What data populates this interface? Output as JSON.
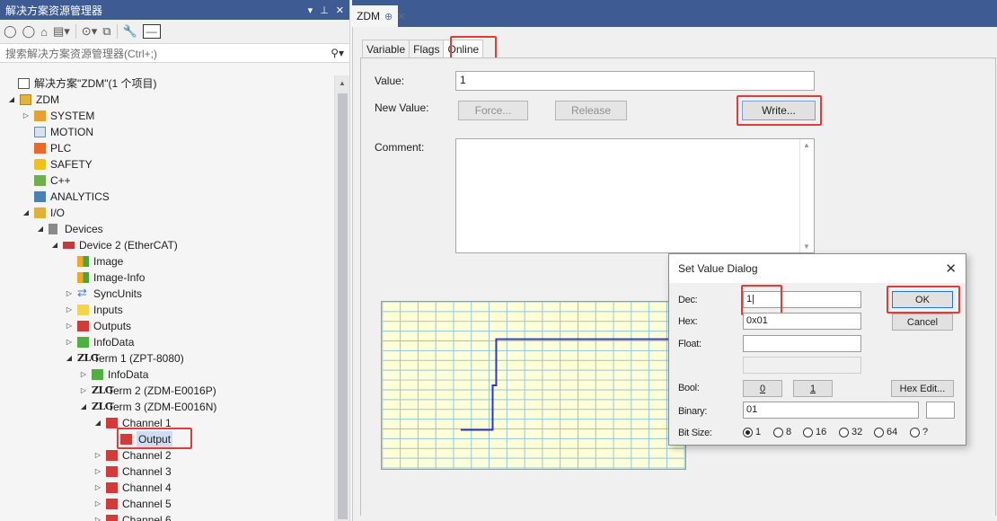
{
  "explorer": {
    "title": "解决方案资源管理器",
    "title_controls": [
      "▾",
      "⊥",
      "✕"
    ],
    "search_placeholder": "搜索解决方案资源管理器(Ctrl+;)",
    "tree": [
      {
        "label": "解决方案\"ZDM\"(1 个项目)",
        "icon": "solution-icon"
      },
      {
        "label": "ZDM",
        "icon": "project-icon"
      },
      {
        "label": "SYSTEM",
        "icon": "system-icon"
      },
      {
        "label": "MOTION",
        "icon": "motion-icon"
      },
      {
        "label": "PLC",
        "icon": "plc-icon"
      },
      {
        "label": "SAFETY",
        "icon": "safety-icon"
      },
      {
        "label": "C++",
        "icon": "cpp-icon"
      },
      {
        "label": "ANALYTICS",
        "icon": "analytics-icon"
      },
      {
        "label": "I/O",
        "icon": "io-icon"
      },
      {
        "label": "Devices",
        "icon": "devices-icon"
      },
      {
        "label": "Device 2 (EtherCAT)",
        "icon": "ethercat-device-icon"
      },
      {
        "label": "Image",
        "icon": "image-icon"
      },
      {
        "label": "Image-Info",
        "icon": "image-info-icon"
      },
      {
        "label": "SyncUnits",
        "icon": "syncunits-icon"
      },
      {
        "label": "Inputs",
        "icon": "inputs-icon"
      },
      {
        "label": "Outputs",
        "icon": "outputs-icon"
      },
      {
        "label": "InfoData",
        "icon": "infodata-icon"
      },
      {
        "label": "Term 1 (ZPT-8080)",
        "icon": "zlg-icon"
      },
      {
        "label": "InfoData",
        "icon": "infodata-icon"
      },
      {
        "label": "Term 2 (ZDM-E0016P)",
        "icon": "zlg-icon"
      },
      {
        "label": "Term 3 (ZDM-E0016N)",
        "icon": "zlg-icon"
      },
      {
        "label": "Channel 1",
        "icon": "channel-icon"
      },
      {
        "label": "Output",
        "icon": "output-var-icon"
      },
      {
        "label": "Channel 2",
        "icon": "channel-icon"
      },
      {
        "label": "Channel 3",
        "icon": "channel-icon"
      },
      {
        "label": "Channel 4",
        "icon": "channel-icon"
      },
      {
        "label": "Channel 5",
        "icon": "channel-icon"
      },
      {
        "label": "Channel 6",
        "icon": "channel-icon"
      }
    ],
    "zlg_logo_text": "ZLG"
  },
  "doc_tab": {
    "label": "ZDM",
    "pin": "⊕",
    "close": "✕"
  },
  "tabs": [
    "Variable",
    "Flags",
    "Online"
  ],
  "online": {
    "value_label": "Value:",
    "value": "1",
    "new_value_label": "New Value:",
    "force_button": "Force...",
    "release_button": "Release",
    "write_button": "Write...",
    "comment_label": "Comment:"
  },
  "dialog": {
    "title": "Set Value Dialog",
    "close": "✕",
    "dec_label": "Dec:",
    "dec_value": "1|",
    "hex_label": "Hex:",
    "hex_value": "0x01",
    "float_label": "Float:",
    "float_value": "",
    "bool_label": "Bool:",
    "bool_false": "0",
    "bool_true": "1",
    "hex_edit_button": "Hex Edit...",
    "binary_label": "Binary:",
    "binary_value": "01",
    "bitsize_label": "Bit Size:",
    "bitsize_options": [
      "1",
      "8",
      "16",
      "32",
      "64",
      "?"
    ],
    "bitsize_selected": "1",
    "ok_button": "OK",
    "cancel_button": "Cancel"
  },
  "colors": {
    "titlebar": "#3f5b93",
    "highlight": "#e53a3a",
    "plot_bg": "#ffffd8",
    "plot_grid": "#8fc7d8",
    "plot_line": "#2a35c9"
  }
}
